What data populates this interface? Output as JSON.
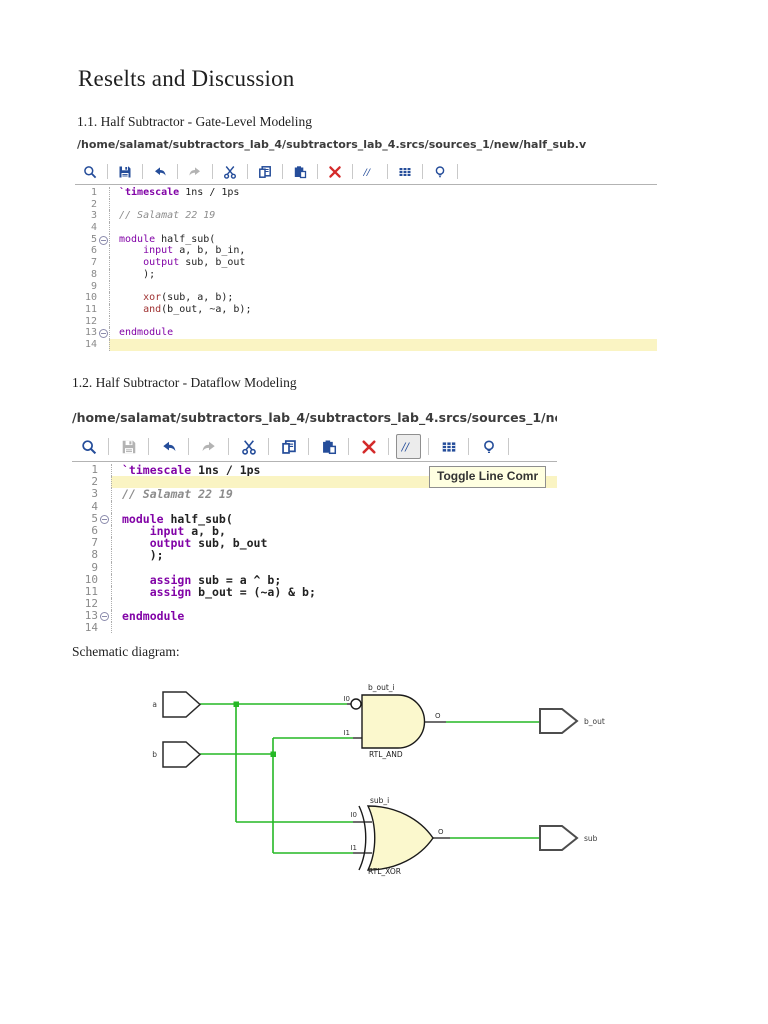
{
  "document": {
    "title": "Reselts and Discussion",
    "sections": [
      {
        "heading": "1.1. Half Subtractor - Gate-Level Modeling",
        "path": "/home/salamat/subtractors_lab_4/subtractors_lab_4.srcs/sources_1/new/half_sub.v"
      },
      {
        "heading": "1.2. Half Subtractor - Dataflow Modeling",
        "path": "/home/salamat/subtractors_lab_4/subtractors_lab_4.srcs/sources_1/nev"
      }
    ],
    "schematic_caption": "Schematic diagram:"
  },
  "editors": [
    {
      "toolbar": [
        {
          "icon": "search"
        },
        {
          "icon": "save"
        },
        {
          "icon": "undo"
        },
        {
          "icon": "redo",
          "disabled": true
        },
        {
          "icon": "cut"
        },
        {
          "icon": "copy"
        },
        {
          "icon": "paste"
        },
        {
          "icon": "delete"
        },
        {
          "icon": "toggle-comment"
        },
        {
          "icon": "columns"
        },
        {
          "icon": "lightbulb"
        }
      ],
      "lines": [
        {
          "n": 1,
          "segs": [
            [
              "dir",
              "`timescale"
            ],
            [
              "p",
              " 1ns / 1ps"
            ]
          ]
        },
        {
          "n": 2
        },
        {
          "n": 3,
          "segs": [
            [
              "c",
              "// Salamat 22 19"
            ]
          ]
        },
        {
          "n": 4
        },
        {
          "n": 5,
          "fold": true,
          "segs": [
            [
              "k",
              "module"
            ],
            [
              "p",
              " half_sub("
            ]
          ]
        },
        {
          "n": 6,
          "segs": [
            [
              "p",
              "    "
            ],
            [
              "k",
              "input"
            ],
            [
              "p",
              " a, b, b_in,"
            ]
          ]
        },
        {
          "n": 7,
          "segs": [
            [
              "p",
              "    "
            ],
            [
              "k",
              "output"
            ],
            [
              "p",
              " sub, b_out"
            ]
          ]
        },
        {
          "n": 8,
          "segs": [
            [
              "p",
              "    );"
            ]
          ]
        },
        {
          "n": 9
        },
        {
          "n": 10,
          "segs": [
            [
              "p",
              "    "
            ],
            [
              "prim",
              "xor"
            ],
            [
              "p",
              "(sub, a, b);"
            ]
          ]
        },
        {
          "n": 11,
          "segs": [
            [
              "p",
              "    "
            ],
            [
              "prim",
              "and"
            ],
            [
              "p",
              "(b_out, ~a, b);"
            ]
          ]
        },
        {
          "n": 12
        },
        {
          "n": 13,
          "fold": true,
          "segs": [
            [
              "k",
              "endmodule"
            ]
          ]
        },
        {
          "n": 14,
          "hl": true
        }
      ]
    },
    {
      "tooltip": "Toggle Line Comr",
      "toolbar": [
        {
          "icon": "search"
        },
        {
          "icon": "save",
          "disabled": true
        },
        {
          "icon": "undo"
        },
        {
          "icon": "redo",
          "disabled": true
        },
        {
          "icon": "cut"
        },
        {
          "icon": "copy"
        },
        {
          "icon": "paste"
        },
        {
          "icon": "delete"
        },
        {
          "icon": "toggle-comment",
          "pressed": true
        },
        {
          "icon": "columns"
        },
        {
          "icon": "lightbulb"
        }
      ],
      "lines": [
        {
          "n": 1,
          "segs": [
            [
              "dir",
              "`timescale"
            ],
            [
              "p",
              " 1ns / 1ps"
            ]
          ]
        },
        {
          "n": 2,
          "hl": true
        },
        {
          "n": 3,
          "segs": [
            [
              "c",
              "// Salamat 22 19"
            ]
          ]
        },
        {
          "n": 4
        },
        {
          "n": 5,
          "fold": true,
          "segs": [
            [
              "k",
              "module"
            ],
            [
              "p",
              " half_sub("
            ]
          ]
        },
        {
          "n": 6,
          "segs": [
            [
              "p",
              "    "
            ],
            [
              "k",
              "input"
            ],
            [
              "p",
              " a, b,"
            ]
          ]
        },
        {
          "n": 7,
          "segs": [
            [
              "p",
              "    "
            ],
            [
              "k",
              "output"
            ],
            [
              "p",
              " sub, b_out"
            ]
          ]
        },
        {
          "n": 8,
          "segs": [
            [
              "p",
              "    );"
            ]
          ]
        },
        {
          "n": 9
        },
        {
          "n": 10,
          "segs": [
            [
              "p",
              "    "
            ],
            [
              "k",
              "assign"
            ],
            [
              "p",
              " sub = a ^ b;"
            ]
          ]
        },
        {
          "n": 11,
          "segs": [
            [
              "p",
              "    "
            ],
            [
              "k",
              "assign"
            ],
            [
              "p",
              " b_out = (~a) & b;"
            ]
          ]
        },
        {
          "n": 12
        },
        {
          "n": 13,
          "fold": true,
          "segs": [
            [
              "k",
              "endmodule"
            ]
          ]
        },
        {
          "n": 14
        }
      ]
    }
  ],
  "schematic": {
    "ports": [
      {
        "name": "a",
        "dir": "in"
      },
      {
        "name": "b",
        "dir": "in"
      },
      {
        "name": "b_out",
        "dir": "out"
      },
      {
        "name": "sub",
        "dir": "out"
      }
    ],
    "gates": [
      {
        "instance": "b_out_i",
        "type": "RTL_AND",
        "pins": {
          "in": [
            "I0",
            "I1"
          ],
          "out": "O"
        },
        "i0_inverted": true
      },
      {
        "instance": "sub_i",
        "type": "RTL_XOR",
        "pins": {
          "in": [
            "I0",
            "I1"
          ],
          "out": "O"
        },
        "i0_inverted": false
      }
    ]
  },
  "colors": {
    "keyword": "#8204a7",
    "comment": "#8c8c8c",
    "primitive": "#a03333",
    "line_highlight": "#faf4c3",
    "wire_green": "#25b825",
    "gate_fill": "#fbf8cd",
    "icon_blue": "#254d9a",
    "icon_red": "#d42a2a"
  }
}
